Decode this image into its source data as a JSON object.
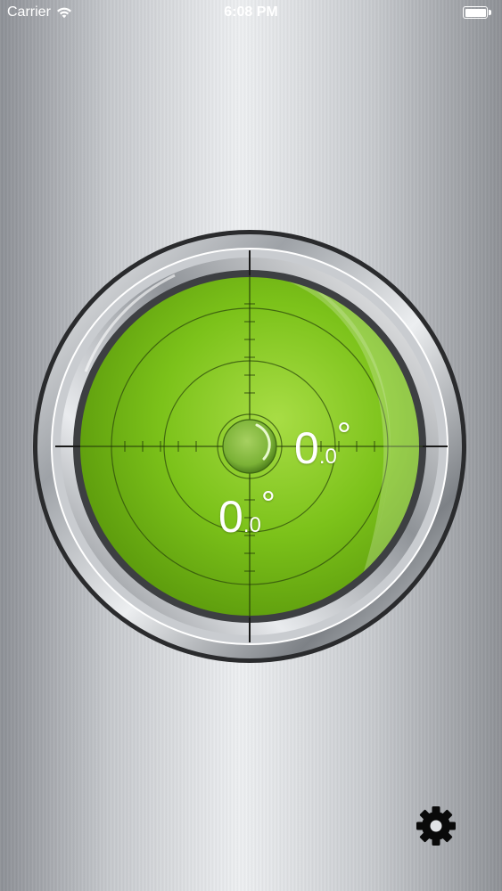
{
  "status_bar": {
    "carrier": "Carrier",
    "time": "6:08 PM",
    "wifi_icon": "wifi-icon",
    "battery_icon": "battery-icon",
    "battery_level": 1.0
  },
  "level": {
    "bubble_color": "#7cc21a",
    "x_reading": {
      "integer": "0",
      "decimal": ".0",
      "unit": "°",
      "value": 0.0
    },
    "y_reading": {
      "integer": "0",
      "decimal": ".0",
      "unit": "°",
      "value": 0.0
    }
  },
  "toolbar": {
    "settings_icon": "gear-icon"
  }
}
